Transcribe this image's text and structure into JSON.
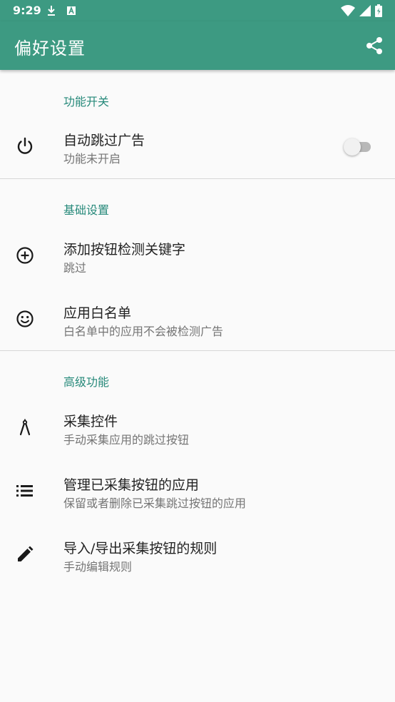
{
  "status_bar": {
    "time": "9:29",
    "left_icons": [
      "download-icon",
      "a-badge-icon"
    ],
    "right_icons": [
      "wifi-icon",
      "signal-icon",
      "battery-icon"
    ]
  },
  "app_bar": {
    "title": "偏好设置",
    "action_icon": "share-icon",
    "color": "#3d9a82"
  },
  "sections": [
    {
      "title": "功能开关",
      "items": [
        {
          "icon": "power-icon",
          "title": "自动跳过广告",
          "subtitle": "功能未开启",
          "toggle": false
        }
      ]
    },
    {
      "title": "基础设置",
      "items": [
        {
          "icon": "add-circle-icon",
          "title": "添加按钮检测关键字",
          "subtitle": "跳过"
        },
        {
          "icon": "smiley-icon",
          "title": "应用白名单",
          "subtitle": "白名单中的应用不会被检测广告"
        }
      ]
    },
    {
      "title": "高级功能",
      "items": [
        {
          "icon": "compass-icon",
          "title": "采集控件",
          "subtitle": "手动采集应用的跳过按钮"
        },
        {
          "icon": "list-icon",
          "title": "管理已采集按钮的应用",
          "subtitle": "保留或者删除已采集跳过按钮的应用"
        },
        {
          "icon": "pencil-icon",
          "title": "导入/导出采集按钮的规则",
          "subtitle": "手动编辑规则"
        }
      ]
    }
  ],
  "accent_color": "#26897a"
}
